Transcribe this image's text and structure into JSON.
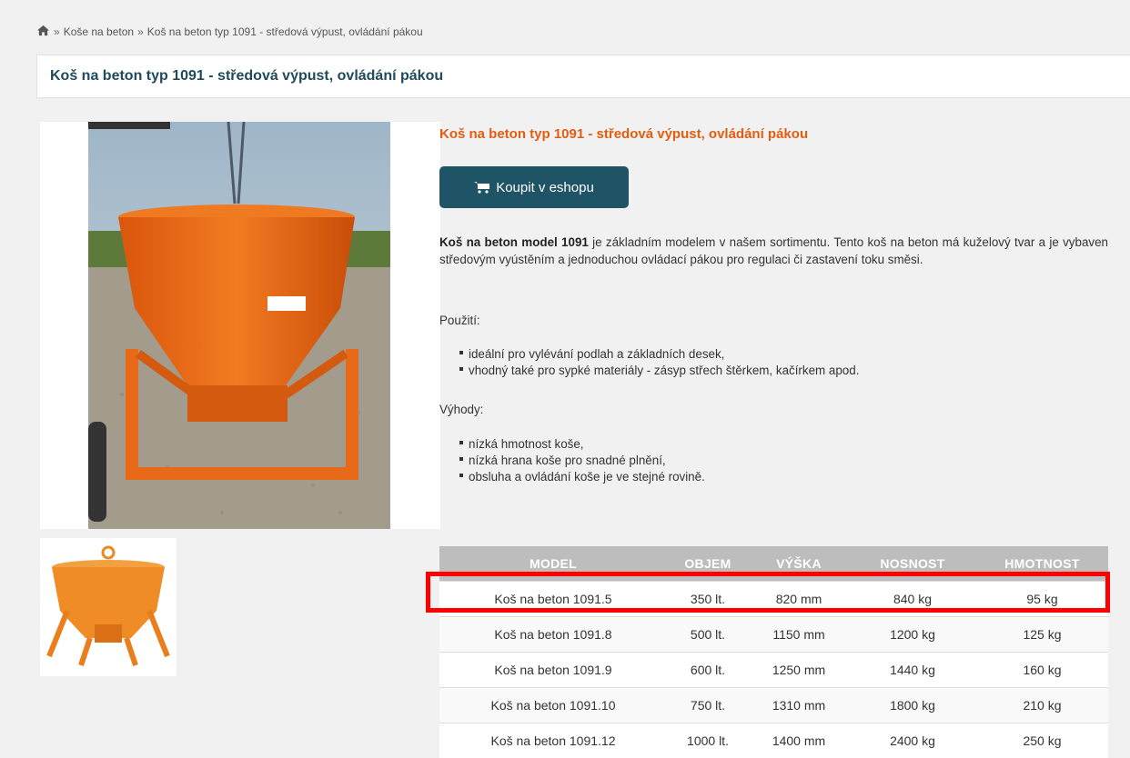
{
  "breadcrumb": {
    "items": [
      "Koše na beton",
      "Koš na beton typ 1091 - středová výpust, ovládání pákou"
    ],
    "separator": "»"
  },
  "page": {
    "title": "Koš na beton typ 1091 - středová výpust, ovládání pákou"
  },
  "product": {
    "title": "Koš na beton typ 1091 - středová výpust, ovládání pákou",
    "buy_label": "Koupit v eshopu",
    "description_bold": "Koš na beton model 1091",
    "description_rest": " je základním modelem v našem sortimentu. Tento koš na beton má kuželový tvar a je vybaven středovým vyústěním a jednoduchou ovládací pákou pro regulaci či zastavení toku směsi.",
    "usage_label": "Použití:",
    "usage_items": [
      "ideální pro vylévání podlah a základních desek,",
      "vhodný také pro sypké materiály - zásyp střech štěrkem, kačírkem apod."
    ],
    "advantages_label": "Výhody:",
    "advantages_items": [
      "nízká hmotnost koše,",
      "nízká hrana koše pro snadné plnění,",
      "obsluha a ovládání koše je ve stejné rovině."
    ]
  },
  "table": {
    "headers": [
      "MODEL",
      "OBJEM",
      "VÝŠKA",
      "NOSNOST",
      "HMOTNOST"
    ],
    "rows": [
      [
        "Koš na beton 1091.5",
        "350 lt.",
        "820 mm",
        "840 kg",
        "95 kg"
      ],
      [
        "Koš na beton 1091.8",
        "500 lt.",
        "1150 mm",
        "1200 kg",
        "125 kg"
      ],
      [
        "Koš na beton 1091.9",
        "600 lt.",
        "1250 mm",
        "1440 kg",
        "160 kg"
      ],
      [
        "Koš na beton 1091.10",
        "750 lt.",
        "1310 mm",
        "1800 kg",
        "210 kg"
      ],
      [
        "Koš na beton 1091.12",
        "1000 lt.",
        "1400 mm",
        "2400 kg",
        "250 kg"
      ]
    ]
  },
  "colors": {
    "title": "#1f4a5c",
    "accent_orange": "#e35d10",
    "button": "#1f5366",
    "highlight": "#ff0000"
  },
  "icons": [
    "home-icon",
    "cart-icon"
  ]
}
